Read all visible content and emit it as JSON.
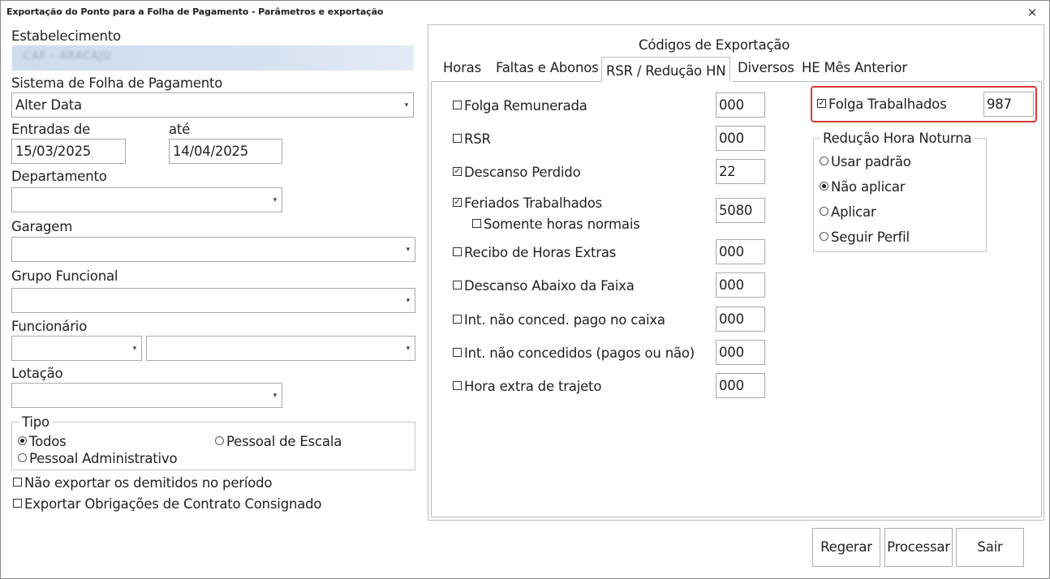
{
  "window": {
    "title": "Exportação do Ponto para a Folha de Pagamento - Parâmetros e exportação",
    "close": "×"
  },
  "left": {
    "estabelecimento_label": "Estabelecimento",
    "estabelecimento_value": "CAF - ARACAJU",
    "sistema_label": "Sistema de Folha de Pagamento",
    "sistema_value": "Alter Data",
    "entradas_label": "Entradas de",
    "entradas_value": "15/03/2025",
    "ate_label": "até",
    "ate_value": "14/04/2025",
    "departamento_label": "Departamento",
    "garagem_label": "Garagem",
    "grupo_label": "Grupo Funcional",
    "funcionario_label": "Funcionário",
    "lotacao_label": "Lotação",
    "tipo": {
      "legend": "Tipo",
      "todos": "Todos",
      "escala": "Pessoal de Escala",
      "admin": "Pessoal Administrativo"
    },
    "nao_exportar": "Não exportar os demitidos no período",
    "obrigacoes": "Exportar Obrigações de Contrato Consignado"
  },
  "right": {
    "header": "Códigos de Exportação",
    "tabs": [
      "Horas",
      "Faltas e Abonos",
      "RSR / Redução HN",
      "Diversos",
      "HE Mês Anterior"
    ],
    "items": [
      {
        "label": "Folga Remunerada",
        "checked": false,
        "code": "000"
      },
      {
        "label": "RSR",
        "checked": false,
        "code": "000"
      },
      {
        "label": "Descanso Perdido",
        "checked": true,
        "code": "22"
      },
      {
        "label": "Feriados Trabalhados",
        "checked": true,
        "code": "5080"
      },
      {
        "label": "Recibo de Horas Extras",
        "checked": false,
        "code": "000"
      },
      {
        "label": "Descanso Abaixo da Faixa",
        "checked": false,
        "code": "000"
      },
      {
        "label": "Int. não conced. pago no caixa",
        "checked": false,
        "code": "000"
      },
      {
        "label": "Int. não concedidos (pagos ou não)",
        "checked": false,
        "code": "000"
      },
      {
        "label": "Hora extra de trajeto",
        "checked": false,
        "code": "000"
      }
    ],
    "somente": "Somente horas normais",
    "folga_trabalhados": {
      "label": "Folga Trabalhados",
      "checked": true,
      "code": "987"
    },
    "reducao": {
      "legend": "Redução Hora Noturna",
      "options": [
        "Usar padrão",
        "Não aplicar",
        "Aplicar",
        "Seguir Perfil"
      ],
      "selected": 1
    }
  },
  "buttons": {
    "regerar": "Regerar",
    "processar": "Processar",
    "sair": "Sair"
  },
  "colors": {
    "highlight": "#d9383a",
    "blurred_field": "#d6e1f0"
  }
}
